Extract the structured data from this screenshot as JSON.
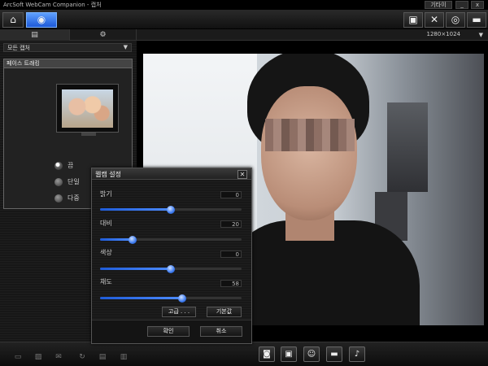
{
  "window": {
    "title": "ArcSoft WebCam Companion - 캡처",
    "user_button": "기타이",
    "minimize": "_",
    "close": "x"
  },
  "toolbar": {
    "left_icons": [
      "home-icon",
      "webcam-capture-icon"
    ],
    "right_icons": [
      "monitor-settings-icon",
      "tools-icon",
      "webcam-icon",
      "folder-icon"
    ]
  },
  "subbar": {
    "tab1_icon": "folder-icon",
    "tab2_icon": "webcam-settings-icon",
    "resolution": "1280×1024",
    "resolution_arrow": "▼"
  },
  "left_panel": {
    "mode_select": {
      "label": "모든 캡처",
      "arrow": "▼"
    },
    "face_panel_title": "페이스 트래킹",
    "options": [
      {
        "label": "끔",
        "selected": true
      },
      {
        "label": "단일",
        "selected": false
      },
      {
        "label": "다중",
        "selected": false
      }
    ]
  },
  "dialog": {
    "title": "웹캠 설정",
    "close": "✕",
    "sliders": [
      {
        "label": "밝기",
        "value": "0",
        "fraction": 0.5
      },
      {
        "label": "대비",
        "value": "20",
        "fraction": 0.23
      },
      {
        "label": "색상",
        "value": "0",
        "fraction": 0.5
      },
      {
        "label": "채도",
        "value": "58",
        "fraction": 0.58
      }
    ],
    "advanced_button": "고급 . . .",
    "default_button": "기본값",
    "ok_button": "확인",
    "cancel_button": "취소"
  },
  "bottom_bar": {
    "left_icons": [
      "slideshow-icon",
      "image-icon",
      "email-icon",
      "rotate-icon",
      "print-icon",
      "trash-icon"
    ],
    "capture_icons": [
      "camera-icon",
      "monitor-icon",
      "face-icon",
      "record-icon",
      "microphone-icon"
    ]
  }
}
